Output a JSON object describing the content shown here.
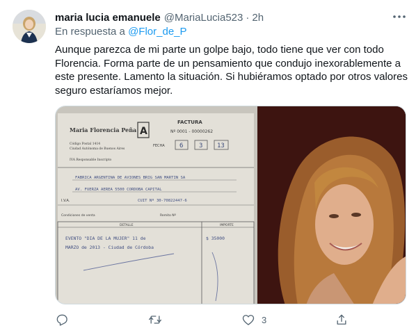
{
  "tweet": {
    "author_name": "maria lucia emanuele",
    "author_handle": "@MariaLucia523",
    "separator": "·",
    "time": "2h",
    "reply_prefix": "En respuesta a",
    "reply_mention": "@Flor_de_P",
    "text": "Aunque parezca  de mi parte un golpe bajo, todo tiene que ver con todo Florencia. Forma parte  de un pensamiento que condujo inexorablemente a este presente.  Lamento la situación.  Si hubiéramos optado por otros valores seguro estaríamos mejor.",
    "more_icon": "more-dots-icon"
  },
  "media": {
    "invoice": {
      "issuer": "Maria Florencia Peña",
      "letter": "A",
      "doc_title": "FACTURA",
      "number": "Nº 0001 - 00000262",
      "date_label": "FECHA",
      "date_day": "6",
      "date_month": "3",
      "date_year": "13",
      "addr1": "Código Postal 1414",
      "addr2": "Ciudad Autónoma de Buenos Aires",
      "tax_status": "IVA Responsable Inscripto",
      "client_name": "FABRICA ARGENTINA DE AVIONES BRIG SAN MARTIN SA",
      "client_address": "AV. FUERZA AEREA 5500 CORDOBA CAPITAL",
      "iva_label": "I.V.A.",
      "cuit": "CUIT Nº 30-70822447-6",
      "sale_label": "Condiciones de venta",
      "remito_label": "Remito Nº",
      "col_detail": "DETALLE",
      "col_amount": "IMPORTE",
      "line1": "EVENTO \"DIA DE LA MUJER\" 11 de",
      "line2": "MARZO de 2013 - Ciudad de Córdoba",
      "amount": "$ 35000"
    }
  },
  "actions": {
    "reply_icon": "reply-icon",
    "retweet_icon": "retweet-icon",
    "like_icon": "heart-icon",
    "like_count": "3",
    "share_icon": "share-icon"
  }
}
